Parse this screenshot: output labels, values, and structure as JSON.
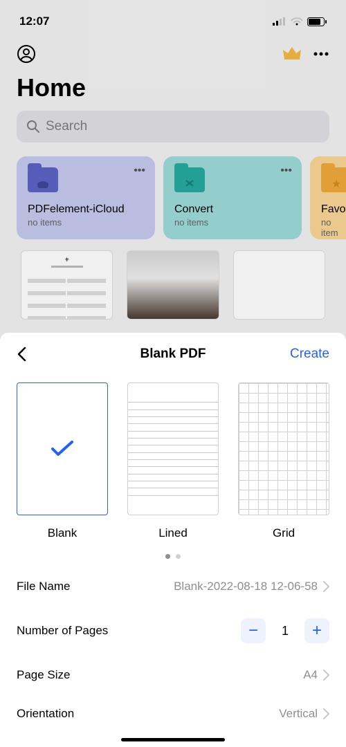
{
  "status": {
    "time": "12:07"
  },
  "page": {
    "title": "Home"
  },
  "search": {
    "placeholder": "Search"
  },
  "cards": [
    {
      "title": "PDFelement-iCloud",
      "sub": "no items"
    },
    {
      "title": "Convert",
      "sub": "no items"
    },
    {
      "title": "Favori",
      "sub": "no item"
    }
  ],
  "sheet": {
    "title": "Blank PDF",
    "create": "Create",
    "templates": [
      {
        "label": "Blank"
      },
      {
        "label": "Lined"
      },
      {
        "label": "Grid"
      }
    ],
    "rows": {
      "filename_label": "File Name",
      "filename_value": "Blank-2022-08-18 12-06-58",
      "pages_label": "Number of Pages",
      "pages_value": "1",
      "size_label": "Page Size",
      "size_value": "A4",
      "orient_label": "Orientation",
      "orient_value": "Vertical"
    }
  }
}
